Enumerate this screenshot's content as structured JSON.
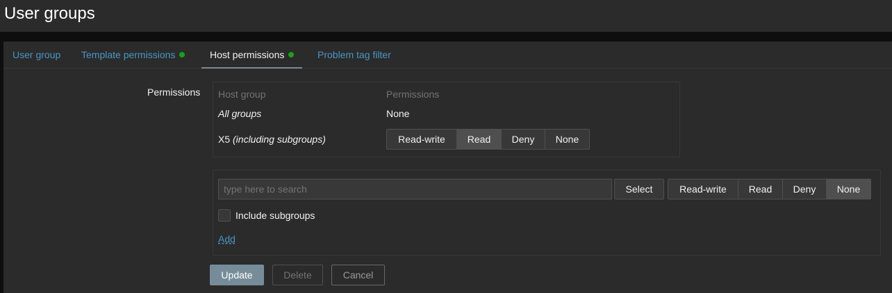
{
  "page": {
    "title": "User groups"
  },
  "tabs": [
    {
      "label": "User group",
      "dot": false,
      "active": false
    },
    {
      "label": "Template permissions",
      "dot": true,
      "active": false
    },
    {
      "label": "Host permissions",
      "dot": true,
      "active": true
    },
    {
      "label": "Problem tag filter",
      "dot": false,
      "active": false
    }
  ],
  "form": {
    "label": "Permissions",
    "table": {
      "headers": {
        "host_group": "Host group",
        "permissions": "Permissions"
      },
      "rows": [
        {
          "group": "All groups",
          "permission": "None"
        },
        {
          "group_prefix": "X5",
          "group_suffix": "(including subgroups)",
          "permission_selected": "Read"
        }
      ]
    },
    "permission_options": [
      "Read-write",
      "Read",
      "Deny",
      "None"
    ],
    "add_section": {
      "search_placeholder": "type here to search",
      "select_label": "Select",
      "selected_permission": "None",
      "include_subgroups_label": "Include subgroups",
      "include_subgroups_checked": false,
      "add_label": "Add"
    }
  },
  "buttons": {
    "update": "Update",
    "delete": "Delete",
    "cancel": "Cancel"
  },
  "colors": {
    "link": "#4796c4",
    "status_dot": "#1a9f1a",
    "primary_button": "#768d99"
  }
}
